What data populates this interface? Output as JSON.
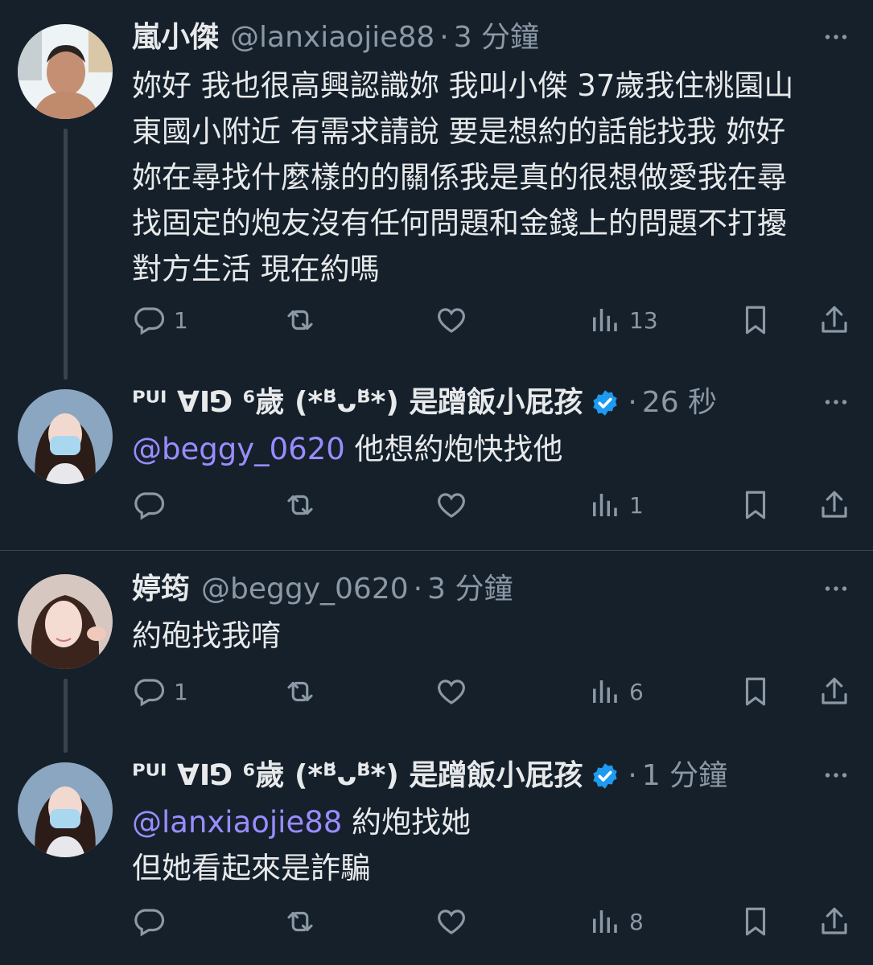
{
  "thread1": {
    "post1": {
      "name": "嵐小傑",
      "handle": "@lanxiaojie88",
      "dot": "·",
      "time": "3 分鐘",
      "text": "妳好 我也很高興認識妳 我叫小傑 37歲我住桃園山\n東國小附近 有需求請說 要是想約的話能找我 妳好\n妳在尋找什麼樣的的關係我是真的很想做愛我在尋\n找固定的炮友沒有任何問題和金錢上的問題不打擾\n對方生活 現在約嗎",
      "replies": "1",
      "reposts": "",
      "likes": "",
      "views": "13"
    },
    "post2": {
      "name": "ᴾᵁᴵ ꓯIꓨ ⁶歲 (*ᴮ̆ᴗᴮ̆*) 是蹭飯小屁孩",
      "handle": "",
      "dot": "·",
      "time": "26 秒",
      "mention": "@beggy_0620",
      "text": " 他想約炮快找他",
      "replies": "",
      "reposts": "",
      "likes": "",
      "views": "1"
    }
  },
  "thread2": {
    "post1": {
      "name": "婷筠",
      "handle": "@beggy_0620",
      "dot": "·",
      "time": "3 分鐘",
      "text": "約砲找我唷",
      "replies": "1",
      "reposts": "",
      "likes": "",
      "views": "6"
    },
    "post2": {
      "name": "ᴾᵁᴵ ꓯIꓨ ⁶歲 (*ᴮ̆ᴗᴮ̆*) 是蹭飯小屁孩",
      "handle": "",
      "dot": "·",
      "time": "1 分鐘",
      "mention": "@lanxiaojie88",
      "text_line1": " 約炮找她",
      "text_line2": "但她看起來是詐騙",
      "replies": "",
      "reposts": "",
      "likes": "",
      "views": "8"
    }
  },
  "colors": {
    "background": "#15202b",
    "text": "#e7e9ea",
    "muted": "#8b98a5",
    "mention": "#9a8cff",
    "verified": "#1d9bf0",
    "divider": "#38444d"
  },
  "icons": [
    "reply-icon",
    "repost-icon",
    "like-icon",
    "views-icon",
    "bookmark-icon",
    "share-icon",
    "more-icon",
    "verified-badge-icon"
  ]
}
